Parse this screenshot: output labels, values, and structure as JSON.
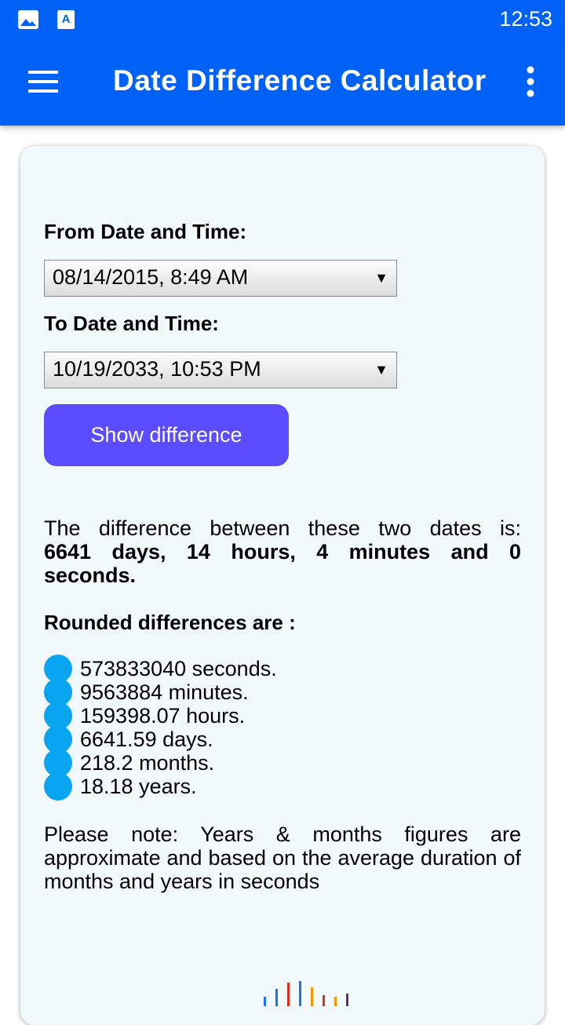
{
  "status_bar": {
    "time": "12:53",
    "icons": [
      "image-icon",
      "font-a-icon"
    ]
  },
  "app_bar": {
    "title": "Date Difference Calculator",
    "menu_icon": "hamburger-menu-icon",
    "overflow_icon": "more-vert-icon"
  },
  "form": {
    "from_label": "From Date and Time:",
    "from_value": "08/14/2015, 8:49 AM",
    "to_label": "To Date and Time:",
    "to_value": "10/19/2033, 10:53 PM",
    "button_label": "Show difference"
  },
  "result": {
    "intro": "The difference between these two dates is:",
    "line1": "6641 days, 14 hours, 4 minutes and 0",
    "line2": "seconds."
  },
  "rounded": {
    "title": "Rounded differences are :",
    "items": [
      "573833040 seconds.",
      "9563884 minutes.",
      "159398.07 hours.",
      "6641.59 days.",
      "218.2 months.",
      "18.18 years."
    ]
  },
  "note": "Please note: Years & months figures are approximate and based on the average duration of months and years in seconds",
  "colors": {
    "app_bar": "#0061f7",
    "button": "#5b4cff",
    "bullet": "#0aa5f0",
    "card": "#f2f9fa"
  }
}
